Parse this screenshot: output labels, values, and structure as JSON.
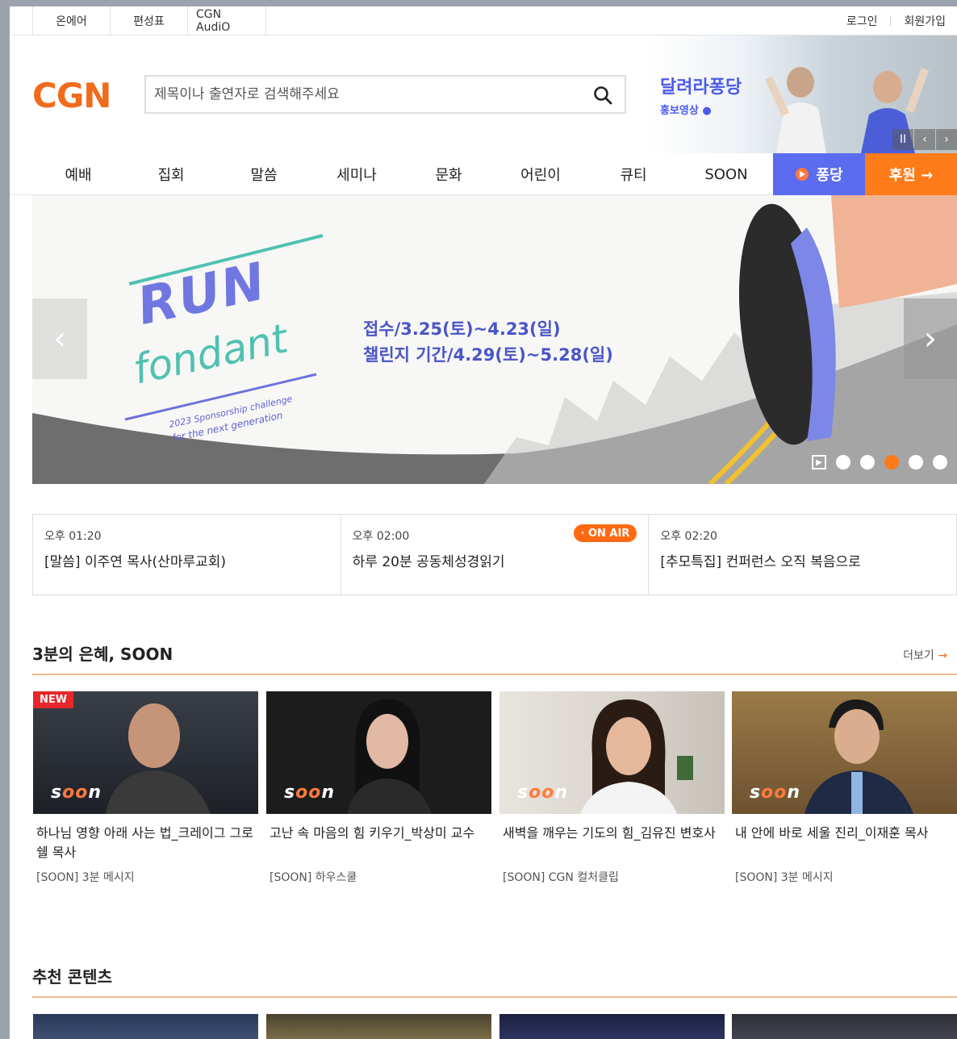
{
  "util": {
    "tabs": [
      "온에어",
      "편성표",
      "CGN AudiO"
    ],
    "login": "로그인",
    "signup": "회원가입"
  },
  "header": {
    "logo": "CGN",
    "search_placeholder": "제목이나 출연자로 검색해주세요",
    "promo_title": "달려라퐁당",
    "promo_sub": "홍보영상 ●",
    "promo_controls": [
      "II",
      "‹",
      "›"
    ]
  },
  "gnb": {
    "items": [
      "예배",
      "집회",
      "말씀",
      "세미나",
      "문화",
      "어린이",
      "큐티",
      "SOON"
    ],
    "pong_label": "퐁당",
    "support_label": "후원 →"
  },
  "hero": {
    "line1": "접수/3.25(토)~4.23(일)",
    "line2": "챌린지 기간/4.29(토)~5.28(일)",
    "run_text": "RUN",
    "fondant_text": "fondant",
    "tagline1": "2023 Sponsorship challenge",
    "tagline2": "for the next generation",
    "active_slide": 3,
    "slide_count": 5
  },
  "schedule": [
    {
      "time": "오후 01:20",
      "title": "[말씀] 이주연 목사(산마루교회)",
      "on_air": ""
    },
    {
      "time": "오후 02:00",
      "title": "하루 20분 공동체성경읽기",
      "on_air": "· ON AIR"
    },
    {
      "time": "오후 02:20",
      "title": "[추모특집] 컨퍼런스 오직 복음으로",
      "on_air": ""
    }
  ],
  "soon_section": {
    "title": "3분의 은혜, SOON",
    "more": "더보기",
    "cards": [
      {
        "badge": "NEW",
        "title": "하나님 영향 아래 사는 법_크레이그 그로쉘 목사",
        "sub": "[SOON] 3분 메시지",
        "thumb_color": "#2b2f36"
      },
      {
        "badge": "",
        "title": "고난 속 마음의 힘 키우기_박상미 교수",
        "sub": "[SOON] 하우스쿨",
        "thumb_color": "#1f1f1f"
      },
      {
        "badge": "",
        "title": "새벽을 깨우는 기도의 힘_김유진 변호사",
        "sub": "[SOON] CGN 컬처클립",
        "thumb_color": "#cfcac3"
      },
      {
        "badge": "",
        "title": "내 안에 바로 세울 진리_이재훈 목사",
        "sub": "[SOON] 3분 메시지",
        "thumb_color": "#8a6a3a"
      }
    ]
  },
  "recommend_section": {
    "title": "추천 콘텐츠"
  },
  "colors": {
    "brand_orange": "#f26a1b",
    "pong_blue": "#5b6cf0",
    "support_orange": "#ff7a18",
    "onair": "#ff6a12"
  }
}
